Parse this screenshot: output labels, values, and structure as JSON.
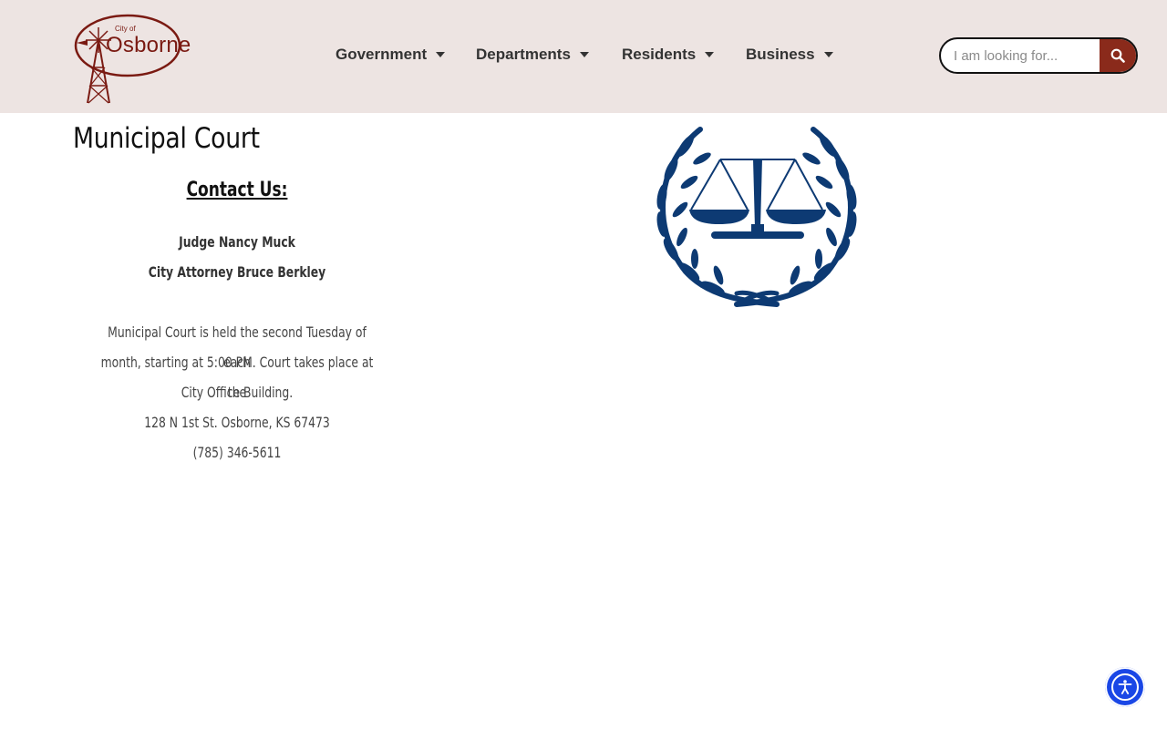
{
  "header": {
    "logo": {
      "small_text": "City of",
      "big_text": "Osborne"
    },
    "nav": [
      {
        "label": "Government"
      },
      {
        "label": "Departments"
      },
      {
        "label": "Residents"
      },
      {
        "label": "Business"
      }
    ],
    "search": {
      "placeholder": "I am looking for...",
      "value": ""
    }
  },
  "main": {
    "title": "Municipal Court",
    "contact_heading": "Contact Us:",
    "people": [
      "Judge Nancy Muck",
      "City Attorney Bruce Berkley"
    ],
    "info_lines": [
      "Municipal Court is held the second Tuesday of each",
      "month, starting at 5:00 PM. Court takes place at the",
      "City Office Building.",
      "128 N 1st St. Osborne, KS 67473",
      "(785) 346-5611"
    ]
  },
  "colors": {
    "header_bg": "#ede4e2",
    "brand": "#7a1a12",
    "search_button": "#8a2a1b",
    "scales": "#0d3a73",
    "accessibility": "#1a47e6"
  },
  "icons": {
    "search": "search-icon",
    "scales": "scales-of-justice-icon",
    "accessibility": "accessibility-icon"
  }
}
